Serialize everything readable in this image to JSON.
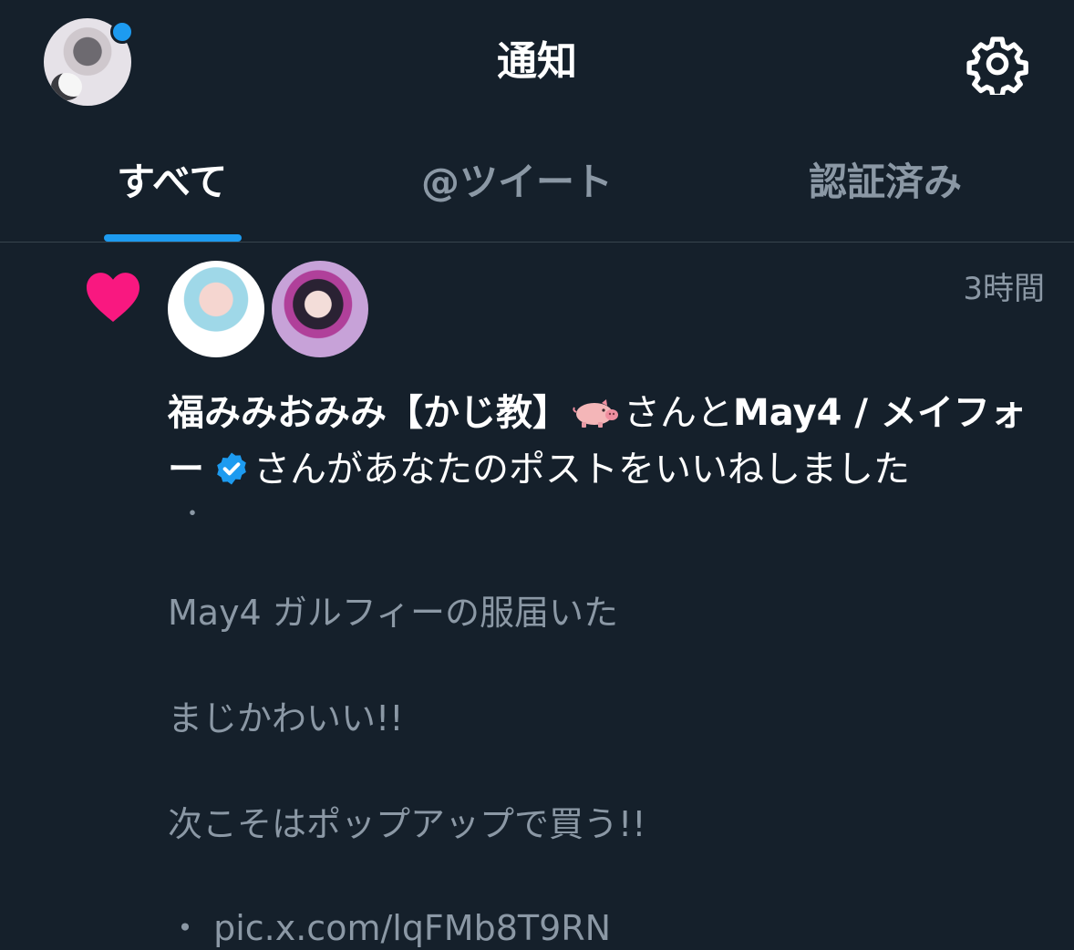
{
  "header": {
    "title": "通知",
    "has_unread_dot": true
  },
  "tabs": [
    {
      "label": "すべて",
      "active": true
    },
    {
      "label": "@ツイート",
      "active": false
    },
    {
      "label": "認証済み",
      "active": false
    }
  ],
  "notification": {
    "type_icon": "heart-icon",
    "time": "3時間",
    "user1": "福みみおみみ【かじ教】",
    "user1_emoji": "pig-emoji",
    "connector": "さんと",
    "user2": "May4 / メイフォー",
    "user2_badge": "verified-icon",
    "action_text": "さんがあなたのポストをいいねしました",
    "post": {
      "bullet": "・",
      "line1": "May4 ガルフィーの服届いた",
      "line2": "まじかわいい!!",
      "line3": "次こそはポップアップで買う!!",
      "line4": "・ pic.x.com/lqFMb8T9RN"
    }
  },
  "colors": {
    "background": "#15202b",
    "accent": "#1d9bf0",
    "heart": "#f91880",
    "secondary_text": "#8b98a5"
  }
}
